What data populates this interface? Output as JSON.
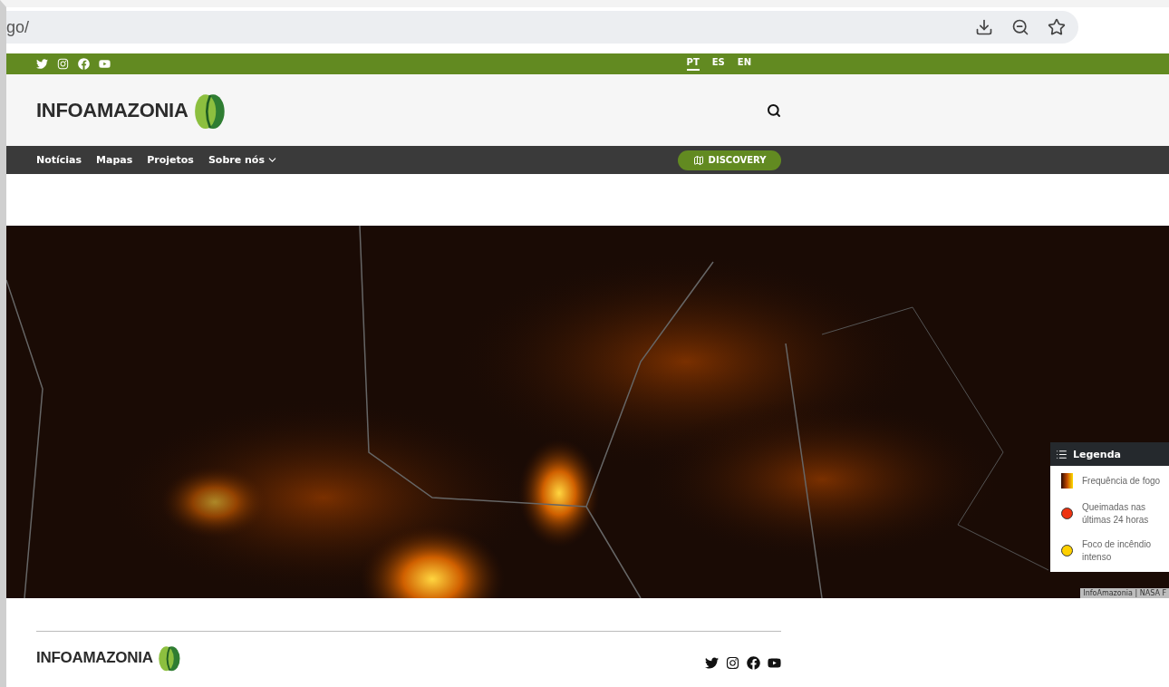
{
  "address_bar": {
    "url": "go/"
  },
  "top_bar": {
    "social_links": [
      {
        "kind": "twitter"
      },
      {
        "kind": "instagram"
      },
      {
        "kind": "facebook"
      },
      {
        "kind": "youtube"
      }
    ],
    "languages": [
      {
        "label": "PT",
        "selected": true
      },
      {
        "label": "ES",
        "selected": false
      },
      {
        "label": "EN",
        "selected": false
      }
    ]
  },
  "header": {
    "logo_text": "INFOAMAZONIA"
  },
  "nav": {
    "items": [
      {
        "label": "Notícias",
        "has_dropdown": false
      },
      {
        "label": "Mapas",
        "has_dropdown": false
      },
      {
        "label": "Projetos",
        "has_dropdown": false
      },
      {
        "label": "Sobre nós",
        "has_dropdown": true
      }
    ],
    "discovery_button": "DISCOVERY"
  },
  "map": {
    "kind": "picture",
    "legend": {
      "title": "Legenda",
      "items": [
        {
          "kind": "gradient",
          "label": "Frequência de fogo"
        },
        {
          "kind": "dot",
          "color": "#ee3311",
          "label": "Queimadas nas últimas 24 horas"
        },
        {
          "kind": "dot",
          "color": "#ffd000",
          "label": "Foco de incêndio intenso"
        }
      ]
    },
    "attribution": "InfoAmazonia | NASA F"
  },
  "footer": {
    "logo_text": "INFOAMAZONIA",
    "social_links": [
      {
        "kind": "twitter"
      },
      {
        "kind": "instagram"
      },
      {
        "kind": "facebook"
      },
      {
        "kind": "youtube"
      }
    ]
  }
}
